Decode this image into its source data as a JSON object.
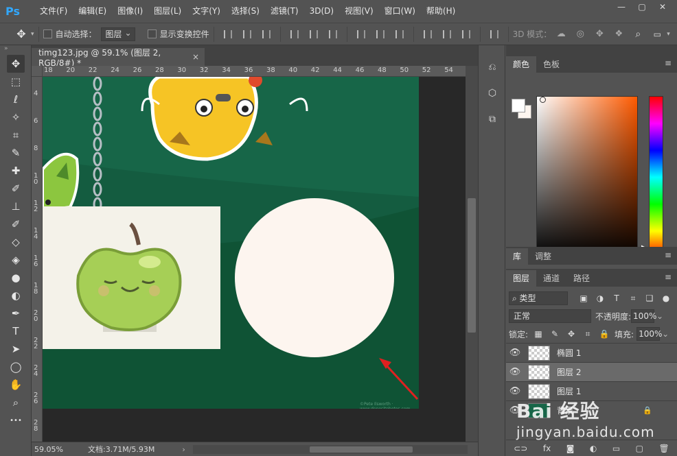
{
  "app": {
    "logo": "Ps"
  },
  "menu": [
    "文件(F)",
    "编辑(E)",
    "图像(I)",
    "图层(L)",
    "文字(Y)",
    "选择(S)",
    "滤镜(T)",
    "3D(D)",
    "视图(V)",
    "窗口(W)",
    "帮助(H)"
  ],
  "window_controls": {
    "minimize": "—",
    "restore": "▢",
    "close": "✕"
  },
  "options": {
    "auto_select_label": "自动选择：",
    "auto_select_value": "图层",
    "show_transform_label": "显示变换控件",
    "mode_3d_label": "3D 模式："
  },
  "document": {
    "tab_title": "timg123.jpg @ 59.1% (图层 2, RGB/8#) *",
    "close": "×",
    "ruler_top": [
      "18",
      "20",
      "22",
      "24",
      "26",
      "28",
      "30",
      "32",
      "34",
      "36",
      "38",
      "40",
      "42",
      "44",
      "46",
      "48",
      "50",
      "52",
      "54"
    ],
    "ruler_left": [
      "4",
      "6",
      "8",
      "1 0",
      "1 2",
      "1 4",
      "1 6",
      "1 8",
      "2 0",
      "2 2",
      "2 4",
      "2 6",
      "2 8"
    ],
    "canvas_credit": "©Pete Ilsworth · www.depositphotos.com",
    "bg_color": "#176648"
  },
  "status": {
    "zoom": "59.05%",
    "doc_size": "文档:3.71M/5.93M",
    "arrow": "›"
  },
  "tools": [
    "move-tool",
    "marquee-tool",
    "lasso-tool",
    "magic-wand-tool",
    "crop-tool",
    "eyedropper-tool",
    "healing-brush-tool",
    "brush-tool",
    "clone-stamp-tool",
    "history-brush-tool",
    "eraser-tool",
    "paint-bucket-tool",
    "blur-tool",
    "dodge-tool",
    "pen-tool",
    "type-tool",
    "path-selection-tool",
    "ellipse-tool",
    "hand-tool",
    "zoom-tool",
    "more-tools"
  ],
  "tool_glyphs": [
    "✥",
    "⬚",
    "ℓ",
    "✧",
    "⌗",
    "✎",
    "✚",
    "✐",
    "⊥",
    "✐",
    "◇",
    "◈",
    "●",
    "◐",
    "✒",
    "T",
    "➤",
    "◯",
    "✋",
    "⌕",
    "•••"
  ],
  "color_panel": {
    "tabs": [
      "颜色",
      "色板"
    ],
    "foreground": "#ffffff",
    "background": "#fdf5ef",
    "hue_hex": "#ff5a00"
  },
  "library_panel": {
    "tabs": [
      "库",
      "调整"
    ]
  },
  "layers_panel": {
    "tabs": [
      "图层",
      "通道",
      "路径"
    ],
    "filter_label": "类型",
    "filter_icons": [
      "image-filter-icon",
      "adjustment-filter-icon",
      "type-filter-icon",
      "shape-filter-icon",
      "smart-object-filter-icon"
    ],
    "filter_glyphs": [
      "▣",
      "◑",
      "T",
      "⌗",
      "❑"
    ],
    "blend_mode": "正常",
    "opacity_label": "不透明度:",
    "opacity_value": "100%",
    "lock_label": "锁定:",
    "lock_glyphs": [
      "▦",
      "✎",
      "✥",
      "⌗",
      "🔒"
    ],
    "fill_label": "填充:",
    "fill_value": "100%",
    "layers": [
      {
        "name": "椭圆 1",
        "visible": true,
        "selected": false
      },
      {
        "name": "图层 2",
        "visible": true,
        "selected": true
      },
      {
        "name": "图层 1",
        "visible": true,
        "selected": false
      },
      {
        "name": "背景",
        "visible": true,
        "selected": false,
        "locked": true
      }
    ],
    "footer_glyphs": [
      "⊂⊃",
      "fx",
      "◙",
      "◐",
      "▭",
      "▢",
      "🗑"
    ]
  },
  "watermark": {
    "brand": "Bai 经验",
    "url": "jingyan.baidu.com"
  }
}
